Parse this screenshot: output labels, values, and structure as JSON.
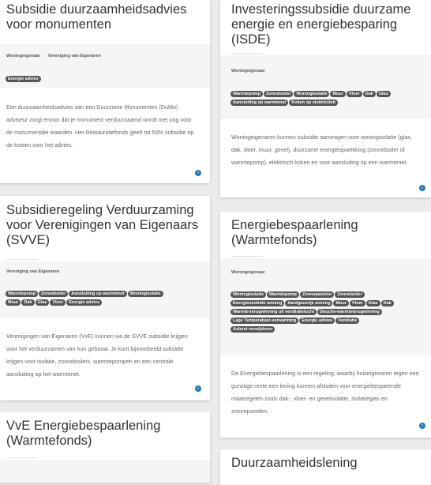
{
  "cards": [
    {
      "title": "Subsidie duurzaamheidsadvies voor monumenten",
      "meta": [
        "Woningeigenaar",
        "Vereniging van Eigenaren"
      ],
      "tags": [
        "Energie advies"
      ],
      "description": "Een duurzaamheidsadvies van een Duurzame Monumenten (DuMo) adviseur zorgt ervoor dat je monument verduurzaamd wordt met oog voor de monumentale waarden. Het Restauratiefonds geeft tot 50% subsidie op de kosten voor het advies.",
      "link_icon": "arrow-right-circle-icon"
    },
    {
      "title": "Investeringssubsidie duurzame energie en energiebesparing (ISDE)",
      "meta": [
        "Woningeigenaar"
      ],
      "tags": [
        "Warmtepomp",
        "Zonneboiler",
        "Woningisolatie",
        "Muur",
        "Vloer",
        "Dak",
        "Glas",
        "Aansluiting op warmtenet",
        "Koken op elektriciteit"
      ],
      "description": "Woningeigenaren kunnen subsidie aanvragen voor woningisolatie (glas, dak, vloer, muur, gevel), duurzame energieopwekking (zonneboiler of warmtepomp), elektrisch koken en voor aansluiting op een warmtenet.",
      "link_icon": "arrow-right-circle-icon"
    },
    {
      "title": "Subsidieregeling Verduurzaming voor Verenigingen van Eigenaars (SVVE)",
      "meta": [
        "Vereniging van Eigenaren"
      ],
      "tags": [
        "Warmtepomp",
        "Zonneboiler",
        "Aansluiting op warmtenet",
        "Woningisolatie",
        "Muur",
        "Dak",
        "Glas",
        "Vloer",
        "Energie advies"
      ],
      "description": "Verenigingen van Eigenaren (VvE) kunnen via de SVVE subsidie krijgen voor het verduurzamen van hun gebouw. Je kunt bijvoorbeeld subsidie krijgen voor isolatie, zonneboilers, warmtepompen en een centrale aansluiting op het warmtenet.",
      "link_icon": "arrow-right-circle-icon"
    },
    {
      "title": "Energiebespaarlening (Warmtefonds)",
      "meta": [
        "Woningeigenaar"
      ],
      "tags": [
        "Woningisolatie",
        "Warmtepomp",
        "Zonnepanelen",
        "Zonneboiler",
        "Energieneutrale woning",
        "Aardgasvrije woning",
        "Muur",
        "Vloer",
        "Glas",
        "Dak",
        "Warmte-terugwinning uit ventilatielucht",
        "Douche-warmteterugwinning",
        "Lage Temperatuur-verwarming",
        "Energie advies",
        "Ventilatie",
        "Asbest verwijderen"
      ],
      "description": "De Energiebespaarlening is een regeling, waarbij huiseigenaren tegen een gunstige rente een lening kunnen afsluiten voor energiebesparende maatregelen zoals dak-, vloer- en gevelisolatie, isolatieglas en zonnepanelen.",
      "link_icon": "arrow-right-circle-icon"
    },
    {
      "title": "VvE Energiebespaarlening (Warmtefonds)"
    },
    {
      "title": "Duurzaamheidslening"
    }
  ]
}
